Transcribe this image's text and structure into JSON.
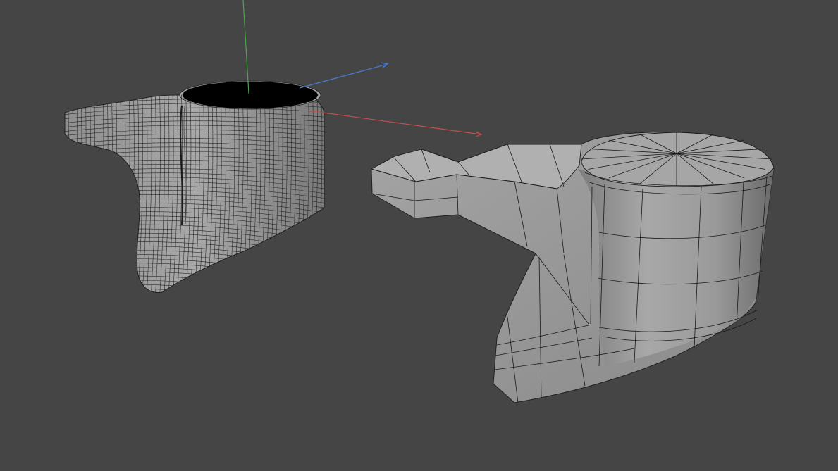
{
  "viewport": {
    "background": "#454545",
    "content": "3d-viewport"
  },
  "scene": {
    "objects": [
      {
        "name": "subdivided-mesh",
        "shading": "gray",
        "wireframe": "dense"
      },
      {
        "name": "base-mesh",
        "shading": "gray",
        "wireframe": "coarse"
      }
    ],
    "gizmo": {
      "axes": [
        {
          "axis": "x",
          "color": "#c0504d"
        },
        {
          "axis": "y",
          "color": "#4ca64c"
        },
        {
          "axis": "z",
          "color": "#4a78c0"
        }
      ]
    }
  }
}
